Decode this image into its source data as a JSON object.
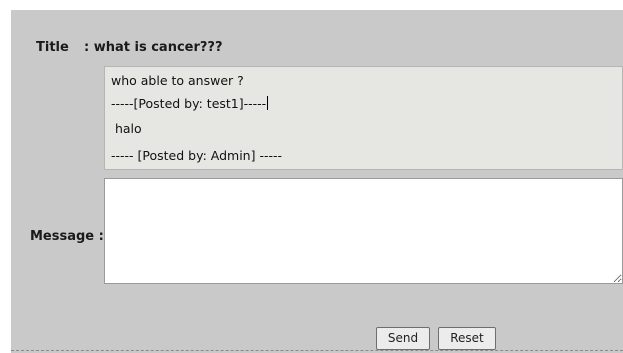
{
  "form": {
    "title_label": "Title",
    "title_value": ": what is cancer???",
    "history_lines": [
      "who able to answer ?",
      "-----[Posted by: test1]-----",
      " halo",
      "----- [Posted by: Admin] -----"
    ],
    "message_label": "Message :",
    "message_value": "",
    "send_label": "Send",
    "reset_label": "Reset"
  }
}
